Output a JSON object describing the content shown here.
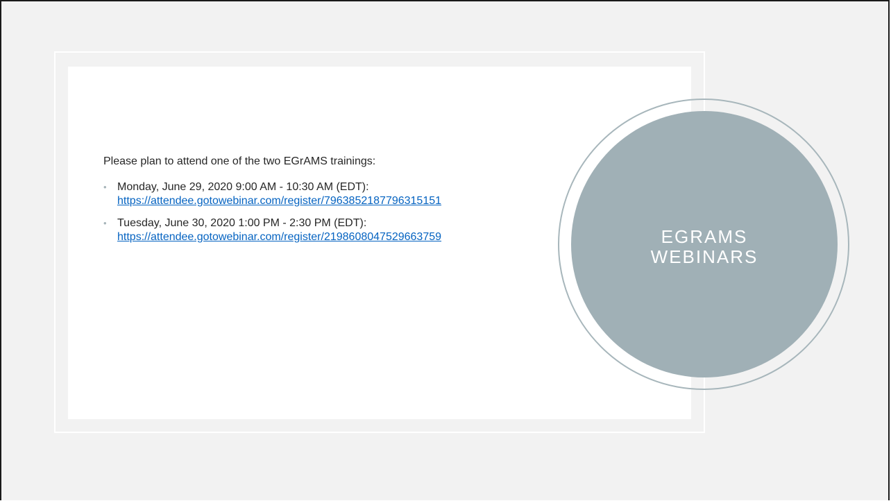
{
  "slide": {
    "title_line1": "EGRAMS",
    "title_line2": "WEBINARS",
    "intro": "Please plan to attend one of the two EGrAMS trainings:",
    "bullets": [
      {
        "text": "Monday, June 29, 2020 9:00 AM - 10:30 AM (EDT):",
        "link": "https://attendee.gotowebinar.com/register/7963852187796315151"
      },
      {
        "text": "Tuesday, June 30, 2020 1:00 PM - 2:30 PM (EDT):",
        "link": "https://attendee.gotowebinar.com/register/2198608047529663759"
      }
    ]
  },
  "colors": {
    "background": "#f2f2f2",
    "content_box": "#ffffff",
    "circle_fill": "#a0b0b6",
    "circle_ring": "#a7b6bb",
    "link": "#0563c1",
    "bullet_marker": "#a6b4b9",
    "text": "#262626"
  }
}
